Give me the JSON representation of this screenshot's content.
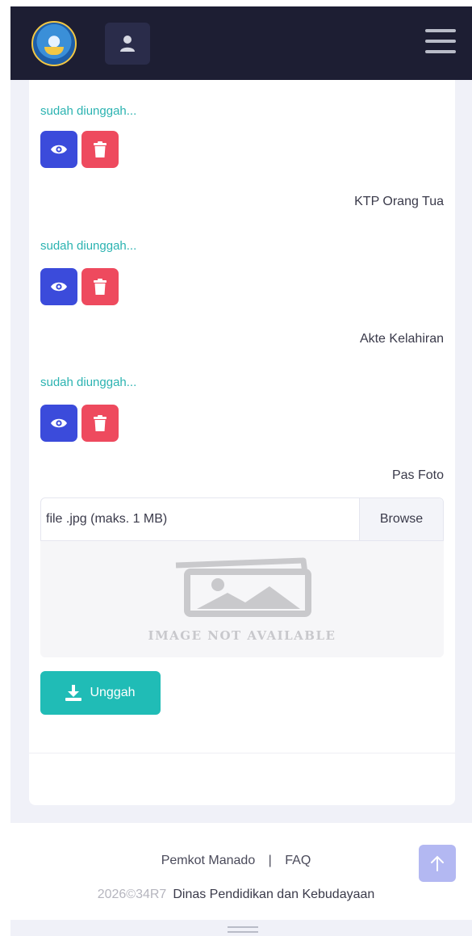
{
  "header": {
    "logo_icon": "tut-wuri-handayani-logo-icon",
    "user_icon": "user-icon",
    "menu_icon": "hamburger-menu-icon",
    "background_color": "#1d1e33"
  },
  "documents": [
    {
      "label": "",
      "status": "sudah diunggah..."
    },
    {
      "label": "KTP Orang Tua",
      "status": "sudah diunggah..."
    },
    {
      "label": "Akte Kelahiran",
      "status": "sudah diunggah..."
    }
  ],
  "actions": {
    "view_icon": "eye-icon",
    "delete_icon": "trash-icon"
  },
  "photo": {
    "label": "Pas Foto",
    "file_placeholder": "file .jpg (maks. 1 MB)",
    "browse_label": "Browse",
    "image_placeholder": "IMAGE NOT AVAILABLE",
    "upload_label": "Unggah",
    "upload_icon": "download-icon"
  },
  "footer": {
    "link_pemkot": "Pemkot Manado",
    "separator": "|",
    "link_faq": "FAQ",
    "copyright_year": "2026©34R7",
    "copyright_text": "Dinas Pendidikan dan Kebudayaan",
    "scroll_top_icon": "arrow-up-icon"
  },
  "colors": {
    "accent_teal": "#20bcb6",
    "view_blue": "#3b4bdb",
    "delete_red": "#ee4a5e",
    "status_teal": "#2bb3b1"
  }
}
